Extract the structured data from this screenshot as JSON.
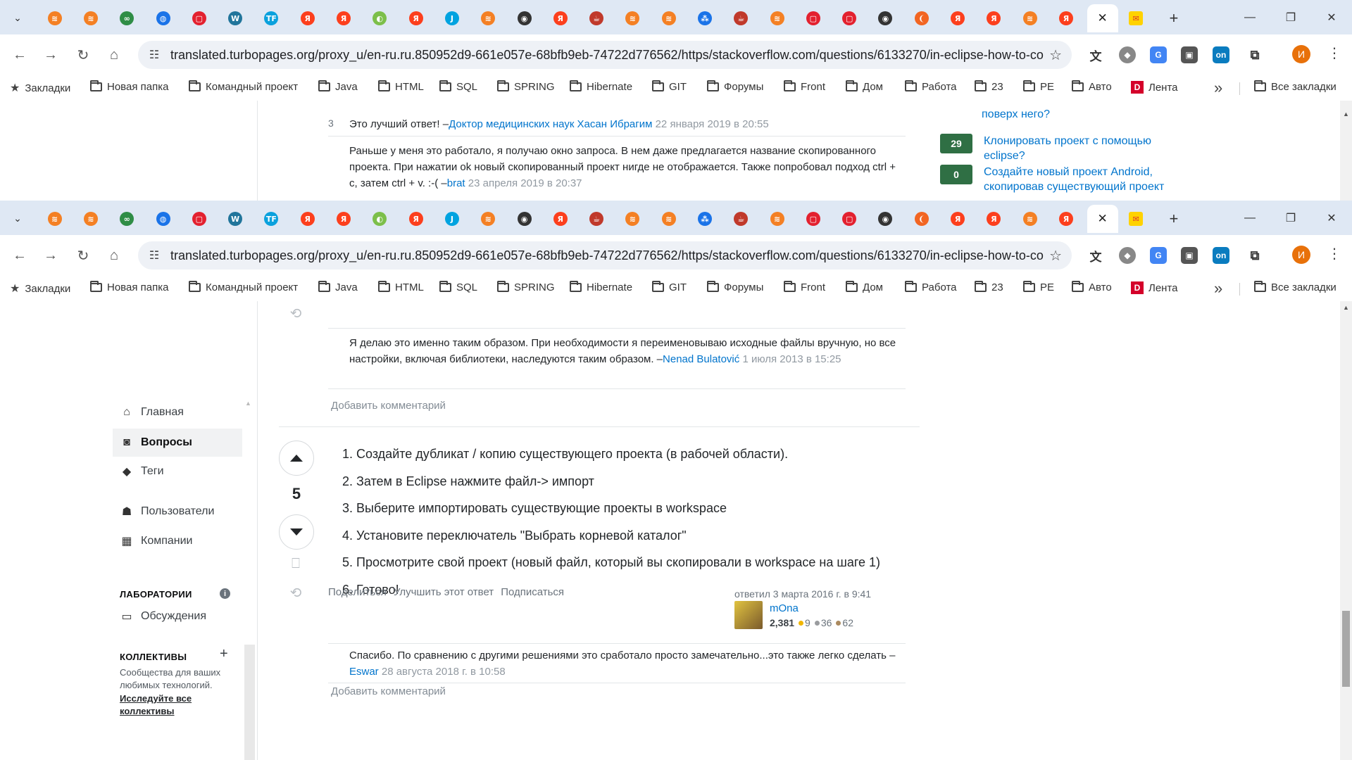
{
  "browser": {
    "url": "translated.turbopages.org/proxy_u/en-ru.ru.850952d9-661e057e-68bfb9eb-74722d776562/https/stackoverflow.com/questions/6133270/in-eclipse-how-to-co...",
    "active_tab_close": "✕",
    "new_tab": "+",
    "profile_initial": "И",
    "tabs": [
      {
        "icon": "stackoverflow-icon",
        "color": "#f48024",
        "glyph": "≋"
      },
      {
        "icon": "stackoverflow-icon",
        "color": "#f48024",
        "glyph": "≋"
      },
      {
        "icon": "glasses-icon",
        "color": "#2f8d46",
        "glyph": "∞"
      },
      {
        "icon": "globe-icon",
        "color": "#1a73e8",
        "glyph": "◍"
      },
      {
        "icon": "red-square-icon",
        "color": "#e3212f",
        "glyph": "▢"
      },
      {
        "icon": "wordpress-icon",
        "color": "#21759b",
        "glyph": "W"
      },
      {
        "icon": "tf-icon",
        "color": "#0aa1dd",
        "glyph": "TF"
      },
      {
        "icon": "yandex-icon",
        "color": "#fc3f1d",
        "glyph": "Я"
      },
      {
        "icon": "yandex-icon",
        "color": "#fc3f1d",
        "glyph": "Я"
      },
      {
        "icon": "earth-icon",
        "color": "#7cbf4a",
        "glyph": "◐"
      },
      {
        "icon": "yandex-icon",
        "color": "#fc3f1d",
        "glyph": "Я"
      },
      {
        "icon": "j-icon",
        "color": "#00a3e0",
        "glyph": "J"
      },
      {
        "icon": "stackoverflow-icon",
        "color": "#f48024",
        "glyph": "≋"
      },
      {
        "icon": "dark-logo-icon",
        "color": "#333333",
        "glyph": "◉"
      },
      {
        "icon": "yandex-icon",
        "color": "#fc3f1d",
        "glyph": "Я"
      },
      {
        "icon": "java-icon",
        "color": "#c0392b",
        "glyph": "☕"
      },
      {
        "icon": "stackoverflow-icon",
        "color": "#f48024",
        "glyph": "≋"
      },
      {
        "icon": "stackoverflow-icon",
        "color": "#f48024",
        "glyph": "≋"
      },
      {
        "icon": "nodes-icon",
        "color": "#1a73e8",
        "glyph": "⁂"
      },
      {
        "icon": "java-icon",
        "color": "#c0392b",
        "glyph": "☕"
      },
      {
        "icon": "stackoverflow-icon",
        "color": "#f48024",
        "glyph": "≋"
      },
      {
        "icon": "red-square-icon",
        "color": "#e3212f",
        "glyph": "▢"
      },
      {
        "icon": "red-square-icon",
        "color": "#e3212f",
        "glyph": "▢"
      },
      {
        "icon": "dark-logo-icon",
        "color": "#333333",
        "glyph": "◉"
      },
      {
        "icon": "orange-icon",
        "color": "#f26522",
        "glyph": "❨"
      },
      {
        "icon": "yandex-icon",
        "color": "#fc3f1d",
        "glyph": "Я"
      },
      {
        "icon": "yandex-icon",
        "color": "#fc3f1d",
        "glyph": "Я"
      },
      {
        "icon": "stackoverflow-icon",
        "color": "#f48024",
        "glyph": "≋"
      },
      {
        "icon": "yandex-icon",
        "color": "#fc3f1d",
        "glyph": "Я"
      }
    ],
    "mail_tab_color": "#ffd200",
    "bookmarks": [
      {
        "label": "Закладки",
        "icon": "star-icon"
      },
      {
        "label": "Новая папка",
        "icon": "folder-icon"
      },
      {
        "label": "Командный проект",
        "icon": "folder-icon"
      },
      {
        "label": "Java",
        "icon": "folder-icon"
      },
      {
        "label": "HTML",
        "icon": "folder-icon"
      },
      {
        "label": "SQL",
        "icon": "folder-icon"
      },
      {
        "label": "SPRING",
        "icon": "folder-icon"
      },
      {
        "label": "Hibernate",
        "icon": "folder-icon"
      },
      {
        "label": "GIT",
        "icon": "folder-icon"
      },
      {
        "label": "Форумы",
        "icon": "folder-icon"
      },
      {
        "label": "Front",
        "icon": "folder-icon"
      },
      {
        "label": "Дом",
        "icon": "folder-icon"
      },
      {
        "label": "Работа",
        "icon": "folder-icon"
      },
      {
        "label": "23",
        "icon": "folder-icon"
      },
      {
        "label": "РЕ",
        "icon": "folder-icon"
      },
      {
        "label": "Авто",
        "icon": "folder-icon"
      },
      {
        "label": "Лента",
        "icon": "dzen-icon"
      }
    ],
    "all_bookmarks": "Все закладки"
  },
  "top_view": {
    "related_top_partial": "поверх него?",
    "comments": [
      {
        "score": "3",
        "text": "Это лучший ответ! –",
        "user": "Доктор медицинских наук Хасан Ибрагим",
        "date": "22 января 2019 в 20:55"
      },
      {
        "score": "",
        "text": "Раньше у меня это работало, я получаю окно запроса. В нем даже предлагается название скопированного проекта. При нажатии ok новый скопированный проект нигде не отображается. Также попробовал подход ctrl + c, затем ctrl + v. :-( –",
        "user": "brat",
        "date": "23 апреля 2019 в 20:37"
      }
    ],
    "related": [
      {
        "count": "29",
        "title": "Клонировать проект с помощью eclipse?"
      },
      {
        "count": "0",
        "title": "Создайте новый проект Android, скопировав существующий проект"
      }
    ]
  },
  "sidebar": {
    "items": [
      {
        "label": "Главная",
        "icon": "home-icon"
      },
      {
        "label": "Вопросы",
        "icon": "questions-icon",
        "active": true
      },
      {
        "label": "Теги",
        "icon": "tag-icon"
      },
      {
        "label": "Пользователи",
        "icon": "users-icon"
      },
      {
        "label": "Компании",
        "icon": "company-icon"
      }
    ],
    "labs_heading": "ЛАБОРАТОРИИ",
    "discussions": "Обсуждения",
    "collectives_heading": "КОЛЛЕКТИВЫ",
    "collectives_text": "Сообщества для ваших любимых технологий.",
    "collectives_link": "Исследуйте все коллективы"
  },
  "prev_comment": {
    "text": "Я делаю это именно таким образом. При необходимости я переименовываю исходные файлы вручную, но все настройки, включая библиотеки, наследуются таким образом. –",
    "user": "Nenad Bulatović",
    "date": "1 июля 2013 в 15:25"
  },
  "add_comment": "Добавить комментарий",
  "answer": {
    "votes": "5",
    "steps": [
      "1. Создайте дубликат / копию существующего проекта (в рабочей области).",
      "2. Затем в Eclipse нажмите файл-> импорт",
      "3. Выберите импортировать существующие проекты в workspace",
      "4. Установите переключатель \"Выбрать корневой каталог\"",
      "5. Просмотрите свой проект (новый файл, который вы скопировали в workspace на шаге 1)",
      "6. Готово!"
    ],
    "menu": [
      "Поделиться",
      "Улучшить этот ответ",
      "Подписаться"
    ],
    "answered": "ответил 3 марта 2016 г. в 9:41",
    "user": "mOna",
    "reputation": "2,381",
    "gold": "9",
    "silver": "36",
    "bronze": "62",
    "badge_colors": {
      "gold": "#f1b600",
      "silver": "#9a9c9f",
      "bronze": "#ab8a5f"
    },
    "comment": {
      "text": "Спасибо. По сравнению с другими решениями это сработало просто замечательно...это также легко сделать –",
      "user": "Eswar",
      "date": "28 августа 2018 г. в 10:58"
    }
  }
}
